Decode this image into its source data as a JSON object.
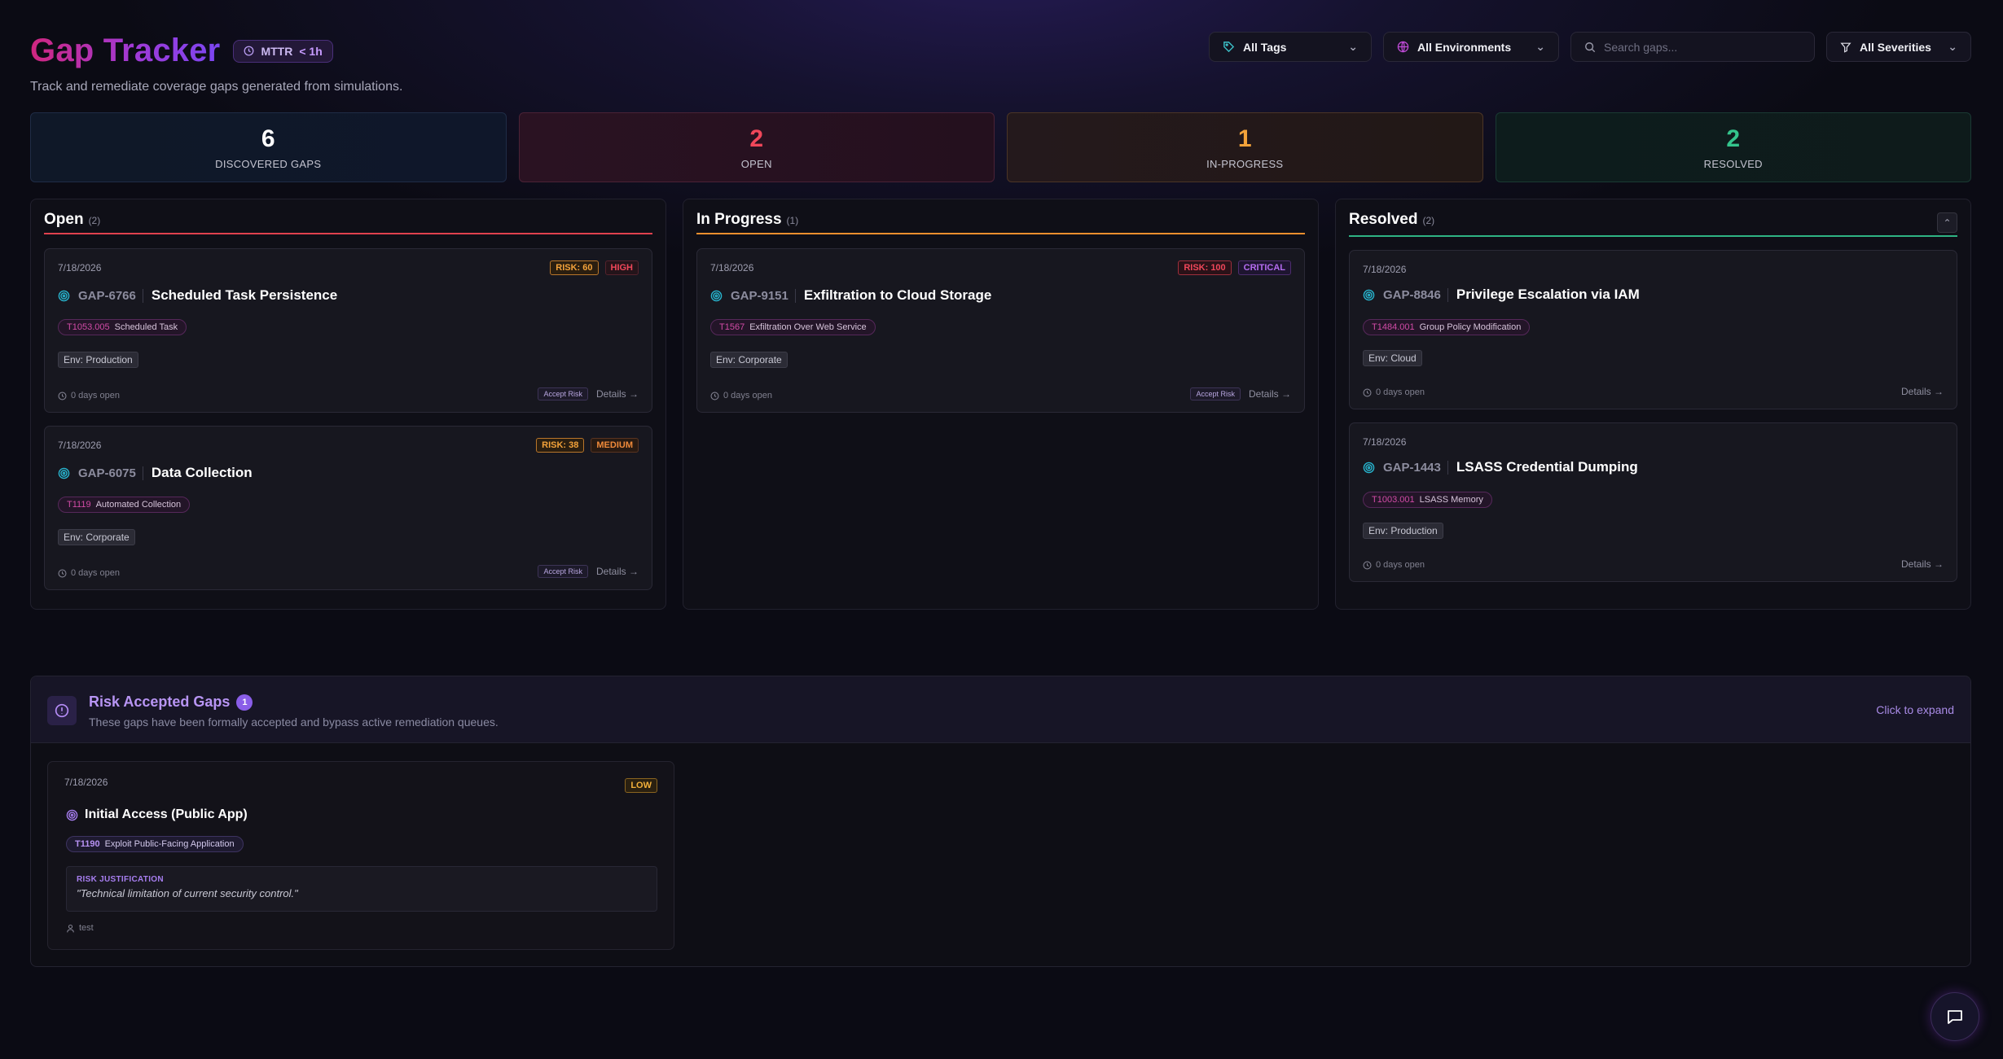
{
  "header": {
    "title": "Gap Tracker",
    "mttr_label": "MTTR",
    "mttr_value": "< 1h",
    "subtitle": "Track and remediate coverage gaps generated from simulations."
  },
  "filters": {
    "tags": "All Tags",
    "environments": "All Environments",
    "search_placeholder": "Search gaps...",
    "severities": "All Severities"
  },
  "stats": [
    {
      "value": "6",
      "label": "DISCOVERED GAPS"
    },
    {
      "value": "2",
      "label": "OPEN"
    },
    {
      "value": "1",
      "label": "IN-PROGRESS"
    },
    {
      "value": "2",
      "label": "RESOLVED"
    }
  ],
  "columns": {
    "open": {
      "title": "Open",
      "count": "(2)",
      "cards": [
        {
          "date": "7/18/2026",
          "risk": "RISK: 60",
          "severity": "HIGH",
          "id": "GAP-6766",
          "name": "Scheduled Task Persistence",
          "technique_id": "T1053.005",
          "technique_name": "Scheduled Task",
          "env": "Env: Production",
          "days": "0 days open",
          "accept": "Accept Risk",
          "details": "Details →"
        },
        {
          "date": "7/18/2026",
          "risk": "RISK: 38",
          "severity": "MEDIUM",
          "id": "GAP-6075",
          "name": "Data Collection",
          "technique_id": "T1119",
          "technique_name": "Automated Collection",
          "env": "Env: Corporate",
          "days": "0 days open",
          "accept": "Accept Risk",
          "details": "Details →"
        }
      ]
    },
    "in_progress": {
      "title": "In Progress",
      "count": "(1)",
      "cards": [
        {
          "date": "7/18/2026",
          "risk": "RISK: 100",
          "severity": "CRITICAL",
          "id": "GAP-9151",
          "name": "Exfiltration to Cloud Storage",
          "technique_id": "T1567",
          "technique_name": "Exfiltration Over Web Service",
          "env": "Env: Corporate",
          "days": "0 days open",
          "accept": "Accept Risk",
          "details": "Details →"
        }
      ]
    },
    "resolved": {
      "title": "Resolved",
      "count": "(2)",
      "cards": [
        {
          "date": "7/18/2026",
          "id": "GAP-8846",
          "name": "Privilege Escalation via IAM",
          "technique_id": "T1484.001",
          "technique_name": "Group Policy Modification",
          "env": "Env: Cloud",
          "days": "0 days open",
          "details": "Details →"
        },
        {
          "date": "7/18/2026",
          "id": "GAP-1443",
          "name": "LSASS Credential Dumping",
          "technique_id": "T1003.001",
          "technique_name": "LSASS Memory",
          "env": "Env: Production",
          "days": "0 days open",
          "details": "Details →"
        }
      ]
    }
  },
  "risk_accepted": {
    "title": "Risk Accepted Gaps",
    "count": "1",
    "subtitle": "These gaps have been formally accepted and bypass active remediation queues.",
    "expand": "Click to expand",
    "card": {
      "date": "7/18/2026",
      "severity": "LOW",
      "name": "Initial Access (Public App)",
      "technique_id": "T1190",
      "technique_name": "Exploit Public-Facing Application",
      "justification_label": "RISK JUSTIFICATION",
      "justification": "\"Technical limitation of current security control.\"",
      "owner": "test"
    }
  },
  "colors": {
    "open": "#e0414e",
    "in_progress": "#ee8f2e",
    "resolved": "#2fb384",
    "accent": "#a77ef0"
  }
}
